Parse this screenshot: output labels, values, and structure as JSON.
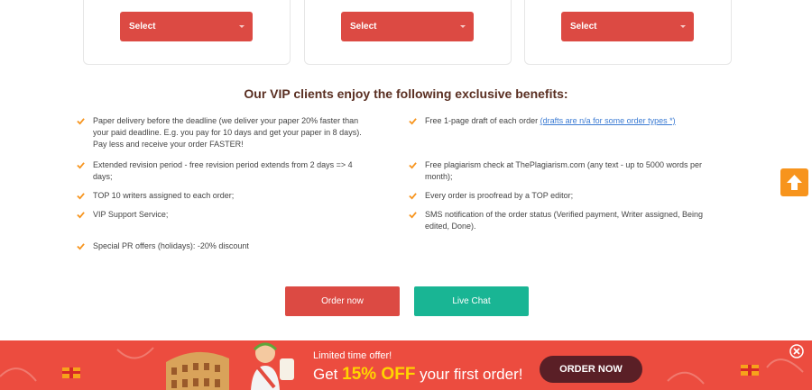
{
  "selects": [
    {
      "label": "Select"
    },
    {
      "label": "Select"
    },
    {
      "label": "Select"
    }
  ],
  "benefits": {
    "heading": "Our VIP clients enjoy the following exclusive benefits:",
    "left": [
      {
        "text": "Paper delivery before the deadline (we deliver your paper 20% faster than your paid deadline. E.g. you pay for 10 days and get your paper in 8 days). Pay less and receive your order FASTER!"
      },
      {
        "text": "Extended revision period - free revision period extends from 2 days => 4 days;"
      },
      {
        "text": "TOP 10 writers assigned to each order;"
      },
      {
        "text": "VIP Support Service;"
      },
      {
        "text": "Special PR offers (holidays): -20% discount"
      }
    ],
    "right": [
      {
        "text": "Free 1-page draft of each order",
        "link": "(drafts are n/a for some order types *)"
      },
      {
        "text": "Free plagiarism check at ThePlagiarism.com (any text - up to 5000 words per month);"
      },
      {
        "text": "Every order is proofread by a TOP editor;"
      },
      {
        "text": "SMS notification of the order status (Verified payment, Writer assigned, Being edited, Done)."
      }
    ]
  },
  "actions": {
    "order_now": "Order now",
    "live_chat": "Live Chat"
  },
  "banner": {
    "limited": "Limited time offer!",
    "get": "Get ",
    "discount": "15% OFF",
    "rest": " your first order!",
    "cta": "ORDER NOW"
  },
  "icons": {
    "scroll_top": "arrow-up-icon",
    "check": "check-icon",
    "close": "close-icon"
  },
  "colors": {
    "primary_red": "#dc4a43",
    "chat_green": "#19b594",
    "scroll_orange": "#f7941d",
    "check_orange": "#f7941d",
    "banner_red": "#ec4c3f",
    "banner_cta": "#5a1f26",
    "discount_yellow": "#ffd400"
  }
}
